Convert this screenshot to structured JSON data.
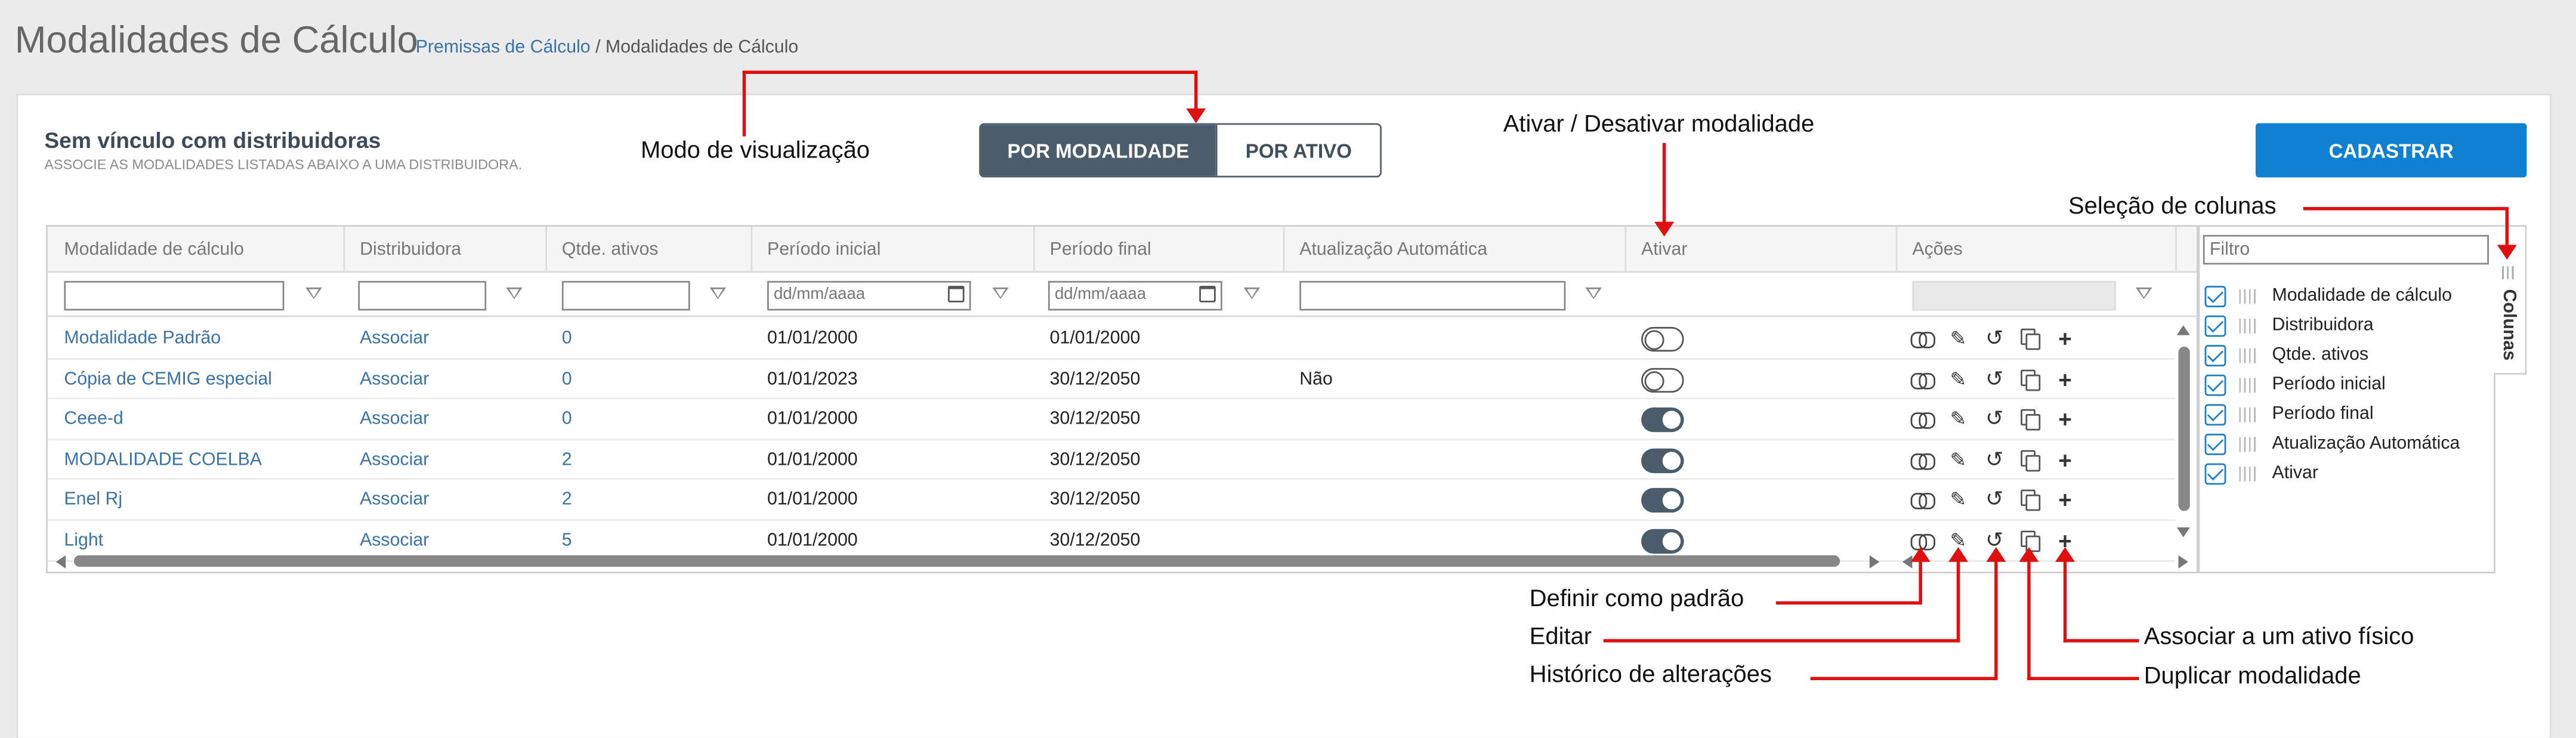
{
  "page": {
    "title": "Modalidades de Cálculo",
    "breadcrumb": {
      "parent": "Premissas de Cálculo",
      "separator": " / ",
      "current": "Modalidades de Cálculo"
    }
  },
  "card": {
    "title": "Sem vínculo com distribuidoras",
    "subtitle": "ASSOCIE AS MODALIDADES LISTADAS ABAIXO A UMA DISTRIBUIDORA."
  },
  "view_toggle": {
    "by_modality": "POR MODALIDADE",
    "by_asset": "POR ATIVO",
    "selected": "POR MODALIDADE"
  },
  "register_button": "CADASTRAR",
  "grid": {
    "columns": [
      "Modalidade de cálculo",
      "Distribuidora",
      "Qtde. ativos",
      "Período inicial",
      "Período final",
      "Atualização Automática",
      "Ativar",
      "Ações"
    ],
    "date_placeholder": "dd/mm/aaaa",
    "rows": [
      {
        "name": "Modalidade Padrão",
        "distributor": "Associar",
        "assets": "0",
        "start": "01/01/2000",
        "end": "01/01/2000",
        "auto": "",
        "active": false
      },
      {
        "name": "Cópia de CEMIG especial",
        "distributor": "Associar",
        "assets": "0",
        "start": "01/01/2023",
        "end": "30/12/2050",
        "auto": "Não",
        "active": false
      },
      {
        "name": "Ceee-d",
        "distributor": "Associar",
        "assets": "0",
        "start": "01/01/2000",
        "end": "30/12/2050",
        "auto": "",
        "active": true
      },
      {
        "name": "MODALIDADE COELBA",
        "distributor": "Associar",
        "assets": "2",
        "start": "01/01/2000",
        "end": "30/12/2050",
        "auto": "",
        "active": true
      },
      {
        "name": "Enel Rj",
        "distributor": "Associar",
        "assets": "2",
        "start": "01/01/2000",
        "end": "30/12/2050",
        "auto": "",
        "active": true
      },
      {
        "name": "Light",
        "distributor": "Associar",
        "assets": "5",
        "start": "01/01/2000",
        "end": "30/12/2050",
        "auto": "",
        "active": true
      }
    ],
    "action_icons": [
      "link-icon",
      "pencil-icon",
      "history-icon",
      "copy-icon",
      "plus-icon"
    ]
  },
  "columns_panel": {
    "tab_label": "Colunas",
    "filter_placeholder": "Filtro",
    "items": [
      {
        "label": "Modalidade de cálculo",
        "checked": true
      },
      {
        "label": "Distribuidora",
        "checked": true
      },
      {
        "label": "Qtde. ativos",
        "checked": true
      },
      {
        "label": "Período inicial",
        "checked": true
      },
      {
        "label": "Período final",
        "checked": true
      },
      {
        "label": "Atualização Automática",
        "checked": true
      },
      {
        "label": "Ativar",
        "checked": true
      }
    ]
  },
  "annotations": {
    "view_mode": "Modo de visualização",
    "toggle_active": "Ativar / Desativar modalidade",
    "column_selection": "Seleção de colunas",
    "set_default": "Definir como padrão",
    "edit": "Editar",
    "history": "Histórico de alterações",
    "associate_asset": "Associar a um ativo físico",
    "duplicate": "Duplicar modalidade"
  },
  "colors": {
    "primary": "#0f7fd1",
    "toggle_dark": "#4b5d6b",
    "link": "#3a73a8",
    "annotation_red": "#e01010"
  }
}
